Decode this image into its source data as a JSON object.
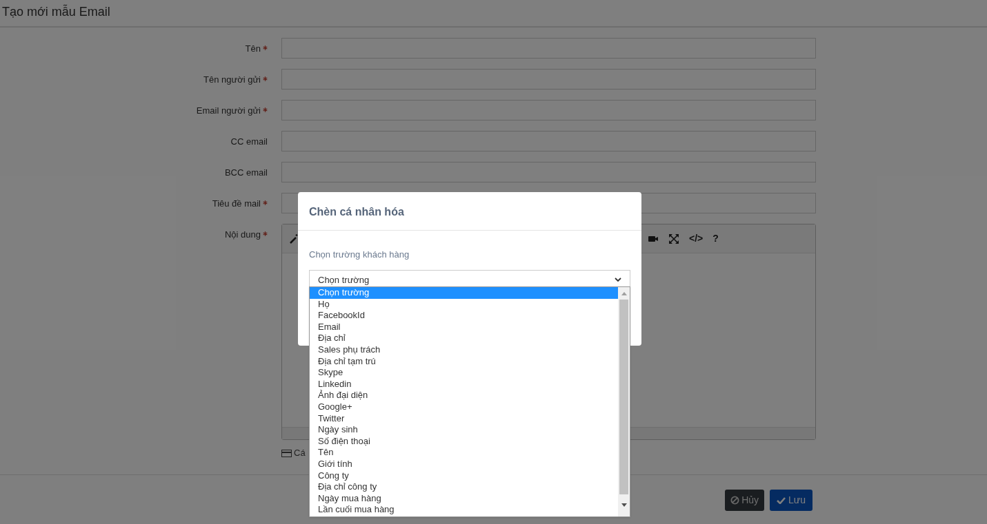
{
  "page": {
    "title": "Tạo mới mẫu Email"
  },
  "form": {
    "fields": [
      {
        "label": "Tên",
        "required": true
      },
      {
        "label": "Tên người gửi",
        "required": true
      },
      {
        "label": "Email người gửi",
        "required": true
      },
      {
        "label": "CC email",
        "required": false
      },
      {
        "label": "BCC email",
        "required": false
      },
      {
        "label": "Tiêu đề mail",
        "required": true
      }
    ],
    "content": {
      "label": "Nội dung",
      "required": true,
      "toolbar": [
        {
          "kind": "wand"
        },
        {
          "kind": "video"
        },
        {
          "kind": "fullscreen"
        },
        {
          "kind": "glyph",
          "text": "</>"
        },
        {
          "kind": "glyph",
          "text": "?"
        }
      ]
    },
    "hint": {
      "text": "Cá"
    }
  },
  "buttons": [
    {
      "kind": "cancel",
      "label": "Hủy"
    },
    {
      "kind": "save",
      "label": "Lưu"
    }
  ],
  "modal": {
    "title": "Chèn cá nhân hóa",
    "label": "Chọn trường khách hàng",
    "select": {
      "value": "Chọn trường",
      "options": [
        {
          "label": "Chọn trường",
          "selected": true
        },
        {
          "label": "Họ",
          "selected": false
        },
        {
          "label": "FacebookId",
          "selected": false
        },
        {
          "label": "Email",
          "selected": false
        },
        {
          "label": "Địa chỉ",
          "selected": false
        },
        {
          "label": "Sales phụ trách",
          "selected": false
        },
        {
          "label": "Địa chỉ tạm trú",
          "selected": false
        },
        {
          "label": "Skype",
          "selected": false
        },
        {
          "label": "Linkedin",
          "selected": false
        },
        {
          "label": "Ảnh đại diện",
          "selected": false
        },
        {
          "label": "Google+",
          "selected": false
        },
        {
          "label": "Twitter",
          "selected": false
        },
        {
          "label": "Ngày sinh",
          "selected": false
        },
        {
          "label": "Số điện thoại",
          "selected": false
        },
        {
          "label": "Tên",
          "selected": false
        },
        {
          "label": "Giới tính",
          "selected": false
        },
        {
          "label": "Công ty",
          "selected": false
        },
        {
          "label": "Địa chỉ công ty",
          "selected": false
        },
        {
          "label": "Ngày mua hàng",
          "selected": false
        },
        {
          "label": "Lần cuối mua hàng",
          "selected": false
        }
      ]
    }
  }
}
